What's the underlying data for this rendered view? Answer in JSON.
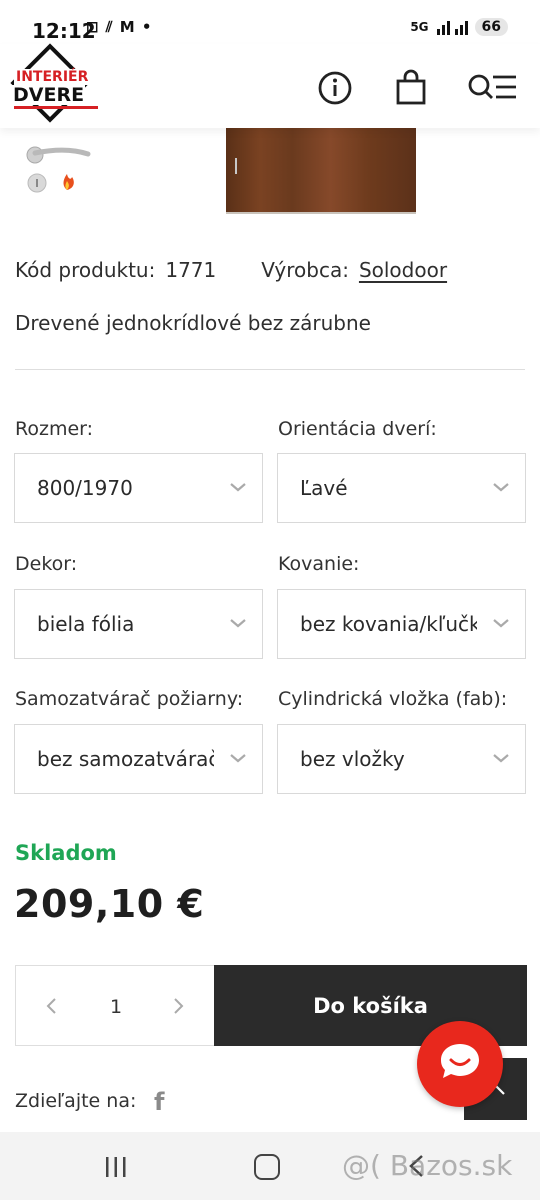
{
  "status_bar": {
    "time": "12:12",
    "left_icons": "⊡ ⫽ M •",
    "network": "5G",
    "battery": "66"
  },
  "header": {
    "logo_line1": "INTERIÉR",
    "logo_line2": "DVERE",
    "icons": [
      "info-icon",
      "shopping-bag-icon",
      "search-menu-icon"
    ]
  },
  "product": {
    "code_label": "Kód produktu:",
    "code_value": "1771",
    "maker_label": "Výrobca:",
    "maker_value": "Solodoor",
    "description": "Drevené jednokrídlové bez zárubne"
  },
  "options": {
    "size": {
      "label": "Rozmer:",
      "value": "800/1970"
    },
    "orientation": {
      "label": "Orientácia dverí:",
      "value": "Ľavé"
    },
    "decor": {
      "label": "Dekor:",
      "value": "biela fólia"
    },
    "hardware": {
      "label": "Kovanie:",
      "value": "bez kovania/kľučky"
    },
    "closer": {
      "label": "Samozatvárač požiarny:",
      "value": "bez samozatvárača"
    },
    "cylinder": {
      "label": "Cylindrická vložka (fab):",
      "value": "bez vložky"
    }
  },
  "stock": {
    "text": "Skladom",
    "color": "#1fa655"
  },
  "price": "209,10 €",
  "quantity": "1",
  "cart_button": "Do košíka",
  "share": {
    "label": "Zdieľajte na:",
    "fb": "f"
  },
  "watermark": "@( Bazos.sk",
  "colors": {
    "accent_red": "#e8281d",
    "dark": "#2b2b2b",
    "logo_red": "#d62024"
  }
}
